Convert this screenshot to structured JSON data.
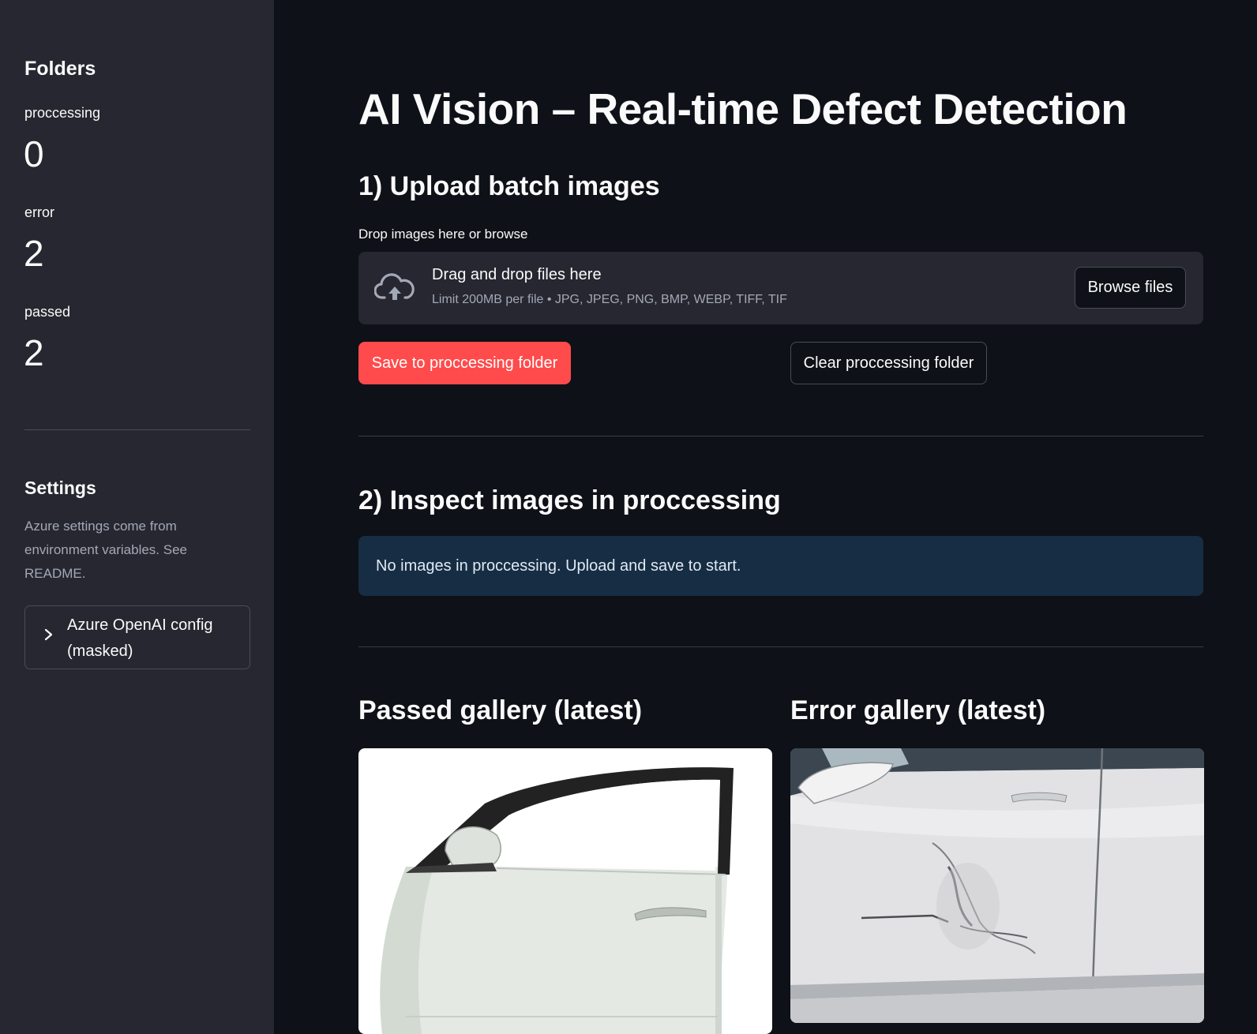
{
  "sidebar": {
    "folders_heading": "Folders",
    "metrics": [
      {
        "label": "proccessing",
        "value": "0"
      },
      {
        "label": "error",
        "value": "2"
      },
      {
        "label": "passed",
        "value": "2"
      }
    ],
    "settings_heading": "Settings",
    "settings_caption": "Azure settings come from environment variables. See README.",
    "expander_label": "Azure OpenAI config (masked)",
    "expander_icon": "chevron-right-icon"
  },
  "main": {
    "title": "AI Vision – Real-time Defect Detection",
    "section1_heading": "1) Upload batch images",
    "uploader": {
      "label": "Drop images here or browse",
      "dropzone_title": "Drag and drop files here",
      "dropzone_subtitle": "Limit 200MB per file • JPG, JPEG, PNG, BMP, WEBP, TIFF, TIF",
      "browse_label": "Browse files",
      "icon": "cloud-upload-icon"
    },
    "save_button_label": "Save to proccessing folder",
    "clear_button_label": "Clear proccessing folder",
    "section2_heading": "2) Inspect images in proccessing",
    "info_message": "No images in proccessing. Upload and save to start.",
    "passed_gallery_heading": "Passed gallery (latest)",
    "error_gallery_heading": "Error gallery (latest)"
  },
  "colors": {
    "background": "#0e1117",
    "sidebar": "#262730",
    "primary": "#ff4b4b",
    "info_bg": "#172d43"
  }
}
